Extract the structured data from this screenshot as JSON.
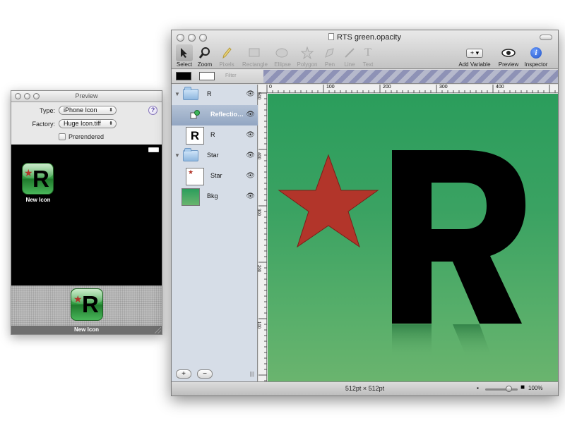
{
  "preview": {
    "title": "Preview",
    "type_label": "Type:",
    "type_value": "iPhone Icon",
    "factory_label": "Factory:",
    "factory_value": "Huge Icon.tiff",
    "prerendered_label": "Prerendered",
    "help_glyph": "?",
    "icon_label_top": "New Icon",
    "icon_label_dock": "New Icon",
    "icon_letter": "R"
  },
  "document": {
    "title": "RTS green.opacity",
    "toolbar": [
      {
        "label": "Select",
        "icon": "arrow-pointer-icon",
        "state": "selected"
      },
      {
        "label": "Zoom",
        "icon": "magnifier-icon",
        "state": "normal"
      },
      {
        "label": "Pixels",
        "icon": "pencil-icon",
        "state": "disabled"
      },
      {
        "label": "Rectangle",
        "icon": "rectangle-icon",
        "state": "disabled"
      },
      {
        "label": "Ellipse",
        "icon": "ellipse-icon",
        "state": "disabled"
      },
      {
        "label": "Polygon",
        "icon": "polygon-star-icon",
        "state": "disabled"
      },
      {
        "label": "Pen",
        "icon": "pen-icon",
        "state": "disabled"
      },
      {
        "label": "Line",
        "icon": "line-icon",
        "state": "disabled"
      },
      {
        "label": "Text",
        "icon": "text-icon",
        "state": "disabled"
      }
    ],
    "add_variable": {
      "label": "Add Variable",
      "glyph": "+ ▾"
    },
    "preview_tool": {
      "label": "Preview"
    },
    "inspector_tool": {
      "label": "Inspector",
      "glyph": "i"
    },
    "filter_label": "Filter",
    "layers": [
      {
        "name": "R",
        "kind": "folder",
        "disclosure": "▼",
        "visible": true
      },
      {
        "name": "Reflectio…",
        "kind": "effect",
        "visible": true,
        "selected": true
      },
      {
        "name": "R",
        "kind": "thumb-R",
        "visible": true
      },
      {
        "name": "Star",
        "kind": "folder",
        "disclosure": "▼",
        "visible": true
      },
      {
        "name": "Star",
        "kind": "thumb-star",
        "visible": true
      },
      {
        "name": "Bkg",
        "kind": "thumb-bkg",
        "visible": true
      }
    ],
    "add_layer": "+",
    "remove_layer": "−",
    "canvas_letter": "R",
    "ruler_h_ticks": [
      "0",
      "100",
      "200",
      "300",
      "400"
    ],
    "ruler_v_ticks": [
      "500",
      "400",
      "300",
      "200",
      "100"
    ],
    "status_size": "512pt × 512pt",
    "zoom": "100%",
    "colors": {
      "star": "#b2352a",
      "canvas_top": "#2b9d5c",
      "canvas_bottom": "#6ab46e",
      "selection": "#92a6c2"
    }
  }
}
